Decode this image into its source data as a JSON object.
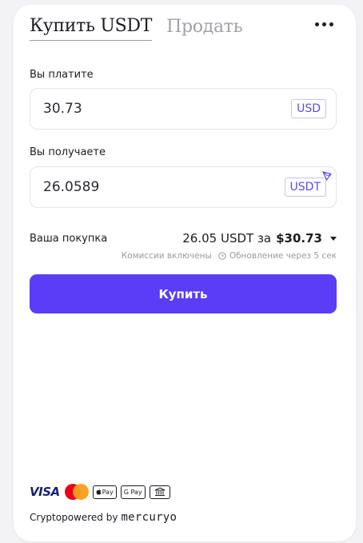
{
  "tabs": {
    "buy_label": "Купить USDT",
    "sell_label": "Продать"
  },
  "pay": {
    "label": "Вы платите",
    "amount": "30.73",
    "currency": "USD"
  },
  "receive": {
    "label": "Вы получаете",
    "amount": "26.0589",
    "currency": "USDT",
    "network_icon": "tron-icon"
  },
  "summary": {
    "label": "Ваша покупка",
    "amount_text": "26.05 USDT за",
    "price": "$30.73",
    "fees_note": "Комиссии включены",
    "update_note": "Обновление через 5 сек"
  },
  "buy_button": "Купить",
  "payment_methods": {
    "visa": "VISA",
    "apple_pay": "Pay",
    "google_pay": "G Pay"
  },
  "footer": {
    "powered_by": "Cryptopowered by",
    "brand": "mercuryo"
  },
  "colors": {
    "accent": "#5b3df5",
    "currency_text": "#5a4af0"
  }
}
